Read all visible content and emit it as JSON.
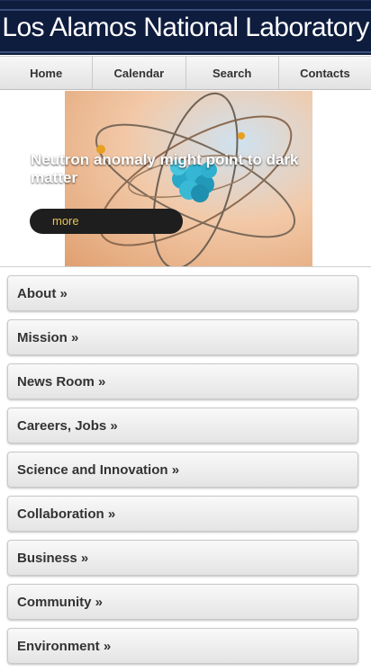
{
  "header": {
    "title": "Los Alamos National Laboratory"
  },
  "nav": {
    "tabs": [
      {
        "label": "Home"
      },
      {
        "label": "Calendar"
      },
      {
        "label": "Search"
      },
      {
        "label": "Contacts"
      }
    ]
  },
  "feature": {
    "headline": "Neutron anomaly might point to dark matter",
    "more_label": "more",
    "image": "atom-illustration"
  },
  "menu": {
    "items": [
      {
        "label": "About »"
      },
      {
        "label": "Mission »"
      },
      {
        "label": "News Room »"
      },
      {
        "label": "Careers, Jobs »"
      },
      {
        "label": "Science and Innovation »"
      },
      {
        "label": "Collaboration »"
      },
      {
        "label": "Business »"
      },
      {
        "label": "Community »"
      },
      {
        "label": "Environment »"
      }
    ]
  },
  "colors": {
    "header_bg": "#0e1c3e",
    "more_button_bg": "#1e1e1e",
    "more_button_text": "#e8c35a"
  }
}
